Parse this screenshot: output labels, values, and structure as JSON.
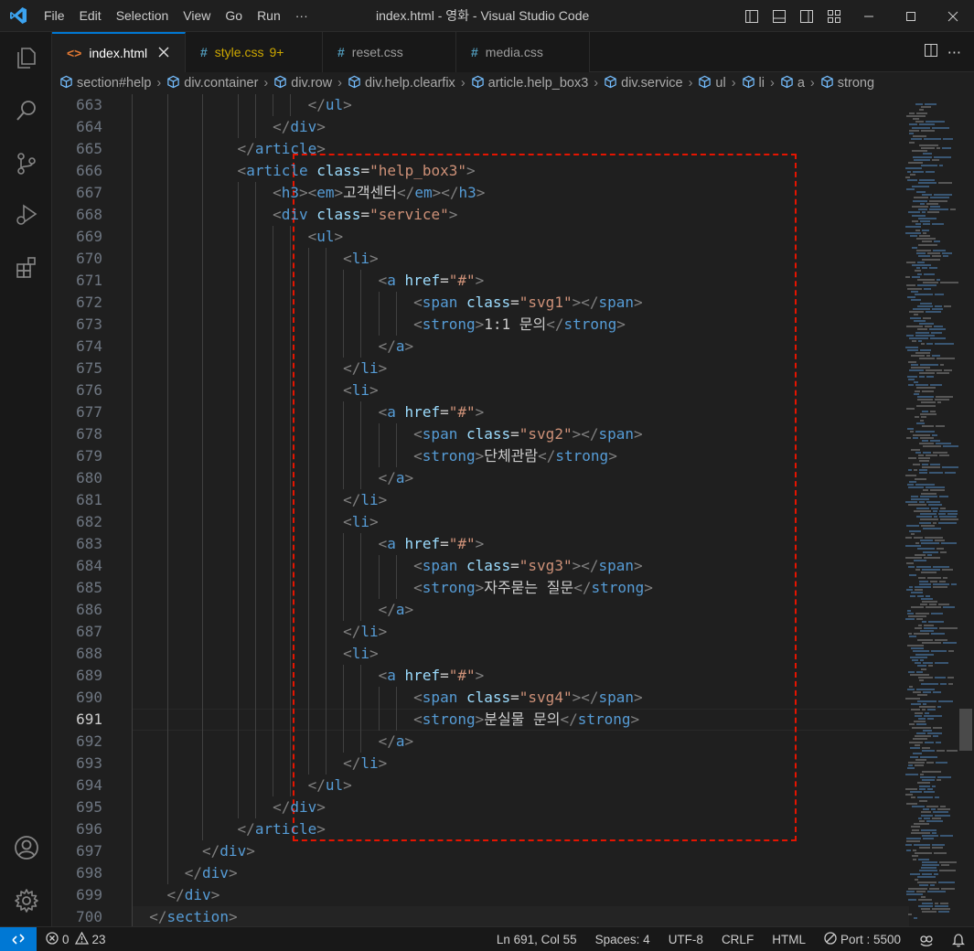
{
  "window": {
    "title": "index.html - 영화 - Visual Studio Code"
  },
  "menu": [
    "File",
    "Edit",
    "Selection",
    "View",
    "Go",
    "Run",
    "···"
  ],
  "tabs": [
    {
      "label": "index.html",
      "icon": "<>",
      "icon_color": "#e37933",
      "active": true
    },
    {
      "label": "style.css",
      "icon": "#",
      "icon_color": "#519aba",
      "badge": "9+",
      "active": false
    },
    {
      "label": "reset.css",
      "icon": "#",
      "icon_color": "#519aba",
      "active": false
    },
    {
      "label": "media.css",
      "icon": "#",
      "icon_color": "#519aba",
      "active": false
    }
  ],
  "breadcrumb": [
    "section#help",
    "div.container",
    "div.row",
    "div.help.clearfix",
    "article.help_box3",
    "div.service",
    "ul",
    "li",
    "a",
    "strong"
  ],
  "lines": [
    {
      "n": "663",
      "indent": 10,
      "parts": [
        [
          "br",
          "</"
        ],
        [
          "tag",
          "ul"
        ],
        [
          "br",
          ">"
        ]
      ]
    },
    {
      "n": "664",
      "indent": 8,
      "parts": [
        [
          "br",
          "</"
        ],
        [
          "tag",
          "div"
        ],
        [
          "br",
          ">"
        ]
      ]
    },
    {
      "n": "665",
      "indent": 6,
      "parts": [
        [
          "br",
          "</"
        ],
        [
          "tag",
          "article"
        ],
        [
          "br",
          ">"
        ]
      ]
    },
    {
      "n": "666",
      "indent": 6,
      "parts": [
        [
          "br",
          "<"
        ],
        [
          "tag",
          "article"
        ],
        [
          "txt",
          " "
        ],
        [
          "attr",
          "class"
        ],
        [
          "txt",
          "="
        ],
        [
          "str",
          "\"help_box3\""
        ],
        [
          "br",
          ">"
        ]
      ]
    },
    {
      "n": "667",
      "indent": 8,
      "parts": [
        [
          "br",
          "<"
        ],
        [
          "tag",
          "h3"
        ],
        [
          "br",
          "><"
        ],
        [
          "tag",
          "em"
        ],
        [
          "br",
          ">"
        ],
        [
          "txt",
          "고객센터"
        ],
        [
          "br",
          "</"
        ],
        [
          "tag",
          "em"
        ],
        [
          "br",
          "></"
        ],
        [
          "tag",
          "h3"
        ],
        [
          "br",
          ">"
        ]
      ]
    },
    {
      "n": "668",
      "indent": 8,
      "parts": [
        [
          "br",
          "<"
        ],
        [
          "tag",
          "div"
        ],
        [
          "txt",
          " "
        ],
        [
          "attr",
          "class"
        ],
        [
          "txt",
          "="
        ],
        [
          "str",
          "\"service\""
        ],
        [
          "br",
          ">"
        ]
      ]
    },
    {
      "n": "669",
      "indent": 10,
      "parts": [
        [
          "br",
          "<"
        ],
        [
          "tag",
          "ul"
        ],
        [
          "br",
          ">"
        ]
      ]
    },
    {
      "n": "670",
      "indent": 12,
      "parts": [
        [
          "br",
          "<"
        ],
        [
          "tag",
          "li"
        ],
        [
          "br",
          ">"
        ]
      ]
    },
    {
      "n": "671",
      "indent": 14,
      "parts": [
        [
          "br",
          "<"
        ],
        [
          "tag",
          "a"
        ],
        [
          "txt",
          " "
        ],
        [
          "attr",
          "href"
        ],
        [
          "txt",
          "="
        ],
        [
          "str",
          "\"#\""
        ],
        [
          "br",
          ">"
        ]
      ]
    },
    {
      "n": "672",
      "indent": 16,
      "parts": [
        [
          "br",
          "<"
        ],
        [
          "tag",
          "span"
        ],
        [
          "txt",
          " "
        ],
        [
          "attr",
          "class"
        ],
        [
          "txt",
          "="
        ],
        [
          "str",
          "\"svg1\""
        ],
        [
          "br",
          "></"
        ],
        [
          "tag",
          "span"
        ],
        [
          "br",
          ">"
        ]
      ]
    },
    {
      "n": "673",
      "indent": 16,
      "parts": [
        [
          "br",
          "<"
        ],
        [
          "tag",
          "strong"
        ],
        [
          "br",
          ">"
        ],
        [
          "txt",
          "1:1 문의"
        ],
        [
          "br",
          "</"
        ],
        [
          "tag",
          "strong"
        ],
        [
          "br",
          ">"
        ]
      ]
    },
    {
      "n": "674",
      "indent": 14,
      "parts": [
        [
          "br",
          "</"
        ],
        [
          "tag",
          "a"
        ],
        [
          "br",
          ">"
        ]
      ]
    },
    {
      "n": "675",
      "indent": 12,
      "parts": [
        [
          "br",
          "</"
        ],
        [
          "tag",
          "li"
        ],
        [
          "br",
          ">"
        ]
      ]
    },
    {
      "n": "676",
      "indent": 12,
      "parts": [
        [
          "br",
          "<"
        ],
        [
          "tag",
          "li"
        ],
        [
          "br",
          ">"
        ]
      ]
    },
    {
      "n": "677",
      "indent": 14,
      "parts": [
        [
          "br",
          "<"
        ],
        [
          "tag",
          "a"
        ],
        [
          "txt",
          " "
        ],
        [
          "attr",
          "href"
        ],
        [
          "txt",
          "="
        ],
        [
          "str",
          "\"#\""
        ],
        [
          "br",
          ">"
        ]
      ]
    },
    {
      "n": "678",
      "indent": 16,
      "parts": [
        [
          "br",
          "<"
        ],
        [
          "tag",
          "span"
        ],
        [
          "txt",
          " "
        ],
        [
          "attr",
          "class"
        ],
        [
          "txt",
          "="
        ],
        [
          "str",
          "\"svg2\""
        ],
        [
          "br",
          "></"
        ],
        [
          "tag",
          "span"
        ],
        [
          "br",
          ">"
        ]
      ]
    },
    {
      "n": "679",
      "indent": 16,
      "parts": [
        [
          "br",
          "<"
        ],
        [
          "tag",
          "strong"
        ],
        [
          "br",
          ">"
        ],
        [
          "txt",
          "단체관람"
        ],
        [
          "br",
          "</"
        ],
        [
          "tag",
          "strong"
        ],
        [
          "br",
          ">"
        ]
      ]
    },
    {
      "n": "680",
      "indent": 14,
      "parts": [
        [
          "br",
          "</"
        ],
        [
          "tag",
          "a"
        ],
        [
          "br",
          ">"
        ]
      ]
    },
    {
      "n": "681",
      "indent": 12,
      "parts": [
        [
          "br",
          "</"
        ],
        [
          "tag",
          "li"
        ],
        [
          "br",
          ">"
        ]
      ]
    },
    {
      "n": "682",
      "indent": 12,
      "parts": [
        [
          "br",
          "<"
        ],
        [
          "tag",
          "li"
        ],
        [
          "br",
          ">"
        ]
      ]
    },
    {
      "n": "683",
      "indent": 14,
      "parts": [
        [
          "br",
          "<"
        ],
        [
          "tag",
          "a"
        ],
        [
          "txt",
          " "
        ],
        [
          "attr",
          "href"
        ],
        [
          "txt",
          "="
        ],
        [
          "str",
          "\"#\""
        ],
        [
          "br",
          ">"
        ]
      ]
    },
    {
      "n": "684",
      "indent": 16,
      "parts": [
        [
          "br",
          "<"
        ],
        [
          "tag",
          "span"
        ],
        [
          "txt",
          " "
        ],
        [
          "attr",
          "class"
        ],
        [
          "txt",
          "="
        ],
        [
          "str",
          "\"svg3\""
        ],
        [
          "br",
          "></"
        ],
        [
          "tag",
          "span"
        ],
        [
          "br",
          ">"
        ]
      ]
    },
    {
      "n": "685",
      "indent": 16,
      "parts": [
        [
          "br",
          "<"
        ],
        [
          "tag",
          "strong"
        ],
        [
          "br",
          ">"
        ],
        [
          "txt",
          "자주묻는 질문"
        ],
        [
          "br",
          "</"
        ],
        [
          "tag",
          "strong"
        ],
        [
          "br",
          ">"
        ]
      ]
    },
    {
      "n": "686",
      "indent": 14,
      "parts": [
        [
          "br",
          "</"
        ],
        [
          "tag",
          "a"
        ],
        [
          "br",
          ">"
        ]
      ]
    },
    {
      "n": "687",
      "indent": 12,
      "parts": [
        [
          "br",
          "</"
        ],
        [
          "tag",
          "li"
        ],
        [
          "br",
          ">"
        ]
      ]
    },
    {
      "n": "688",
      "indent": 12,
      "parts": [
        [
          "br",
          "<"
        ],
        [
          "tag",
          "li"
        ],
        [
          "br",
          ">"
        ]
      ]
    },
    {
      "n": "689",
      "indent": 14,
      "parts": [
        [
          "br",
          "<"
        ],
        [
          "tag",
          "a"
        ],
        [
          "txt",
          " "
        ],
        [
          "attr",
          "href"
        ],
        [
          "txt",
          "="
        ],
        [
          "str",
          "\"#\""
        ],
        [
          "br",
          ">"
        ]
      ]
    },
    {
      "n": "690",
      "indent": 16,
      "parts": [
        [
          "br",
          "<"
        ],
        [
          "tag",
          "span"
        ],
        [
          "txt",
          " "
        ],
        [
          "attr",
          "class"
        ],
        [
          "txt",
          "="
        ],
        [
          "str",
          "\"svg4\""
        ],
        [
          "br",
          "></"
        ],
        [
          "tag",
          "span"
        ],
        [
          "br",
          ">"
        ]
      ]
    },
    {
      "n": "691",
      "indent": 16,
      "parts": [
        [
          "br",
          "<"
        ],
        [
          "tag",
          "strong"
        ],
        [
          "br",
          ">"
        ],
        [
          "txt",
          "분실물 문의"
        ],
        [
          "br",
          "</"
        ],
        [
          "tag",
          "strong"
        ],
        [
          "br",
          ">"
        ]
      ],
      "current": true
    },
    {
      "n": "692",
      "indent": 14,
      "parts": [
        [
          "br",
          "</"
        ],
        [
          "tag",
          "a"
        ],
        [
          "br",
          ">"
        ]
      ]
    },
    {
      "n": "693",
      "indent": 12,
      "parts": [
        [
          "br",
          "</"
        ],
        [
          "tag",
          "li"
        ],
        [
          "br",
          ">"
        ]
      ]
    },
    {
      "n": "694",
      "indent": 10,
      "parts": [
        [
          "br",
          "</"
        ],
        [
          "tag",
          "ul"
        ],
        [
          "br",
          ">"
        ]
      ]
    },
    {
      "n": "695",
      "indent": 8,
      "parts": [
        [
          "br",
          "</"
        ],
        [
          "tag",
          "div"
        ],
        [
          "br",
          ">"
        ]
      ]
    },
    {
      "n": "696",
      "indent": 6,
      "parts": [
        [
          "br",
          "</"
        ],
        [
          "tag",
          "article"
        ],
        [
          "br",
          ">"
        ]
      ]
    },
    {
      "n": "697",
      "indent": 4,
      "parts": [
        [
          "br",
          "</"
        ],
        [
          "tag",
          "div"
        ],
        [
          "br",
          ">"
        ]
      ]
    },
    {
      "n": "698",
      "indent": 3,
      "parts": [
        [
          "br",
          "</"
        ],
        [
          "tag",
          "div"
        ],
        [
          "br",
          ">"
        ]
      ]
    },
    {
      "n": "699",
      "indent": 2,
      "parts": [
        [
          "br",
          "</"
        ],
        [
          "tag",
          "div"
        ],
        [
          "br",
          ">"
        ]
      ]
    },
    {
      "n": "700",
      "indent": 1,
      "parts": [
        [
          "br",
          "</"
        ],
        [
          "tag",
          "section"
        ],
        [
          "br",
          ">"
        ]
      ]
    }
  ],
  "status": {
    "errors": "0",
    "warnings": "23",
    "position": "Ln 691, Col 55",
    "spaces": "Spaces: 4",
    "encoding": "UTF-8",
    "eol": "CRLF",
    "language": "HTML",
    "port": "Port : 5500"
  },
  "colors": {
    "accent": "#0078d4",
    "annotation_box": "#e51400"
  }
}
